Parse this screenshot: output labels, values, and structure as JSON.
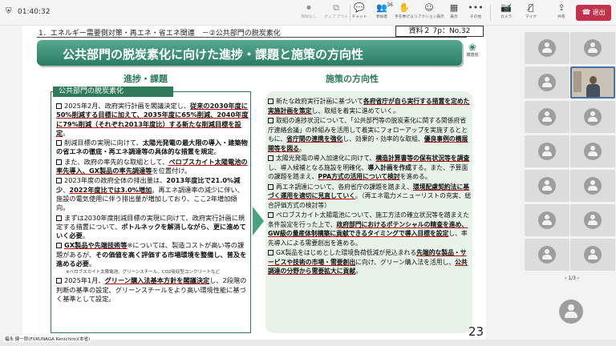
{
  "toolbar": {
    "timer": "01:40:32",
    "items": [
      {
        "icon": "chat-icon",
        "label": "チャット"
      },
      {
        "icon": "people-icon",
        "label": "参加者",
        "count": "36"
      },
      {
        "icon": "hand-icon",
        "label": "手を挙げる"
      },
      {
        "icon": "reaction-icon",
        "label": "リアクション表示"
      },
      {
        "icon": "view-icon",
        "label": "表示"
      },
      {
        "icon": "more-icon",
        "label": "その他"
      },
      {
        "icon": "camera-icon",
        "label": "カメラ"
      },
      {
        "icon": "mic-icon",
        "label": "マイク"
      },
      {
        "icon": "share-icon",
        "label": "共有"
      }
    ],
    "faded": [
      {
        "icon": "record-icon",
        "label": "制限なし"
      },
      {
        "icon": "popout-icon",
        "label": "ポップ アウト"
      }
    ],
    "leave_label": "退出"
  },
  "slide": {
    "doc_header": "1．エネルギー需要側対策・再エネ・省エネ関連　－②公共部門の脱炭素化",
    "doc_tag": "資料２ 7p：No.32",
    "title": "公共部門の脱炭素化に向けた進捗・課題と施策の方向性",
    "logo_label": "環境省",
    "left_heading": "進捗・課題",
    "left_label": "公共部門の脱炭素化",
    "right_heading": "施策の方向性",
    "left_items": [
      {
        "parts": [
          {
            "t": "2025年2月、政府実行計画を閣議決定し、"
          },
          {
            "t": "従来の2030年度に50%削減する目標に加えて、2035年度に65%削減、2040年度に79%削減（それぞれ2013年度比）する新たな削減目標を設定",
            "s": "b ul"
          },
          {
            "t": "。"
          }
        ]
      },
      {
        "parts": [
          {
            "t": "削減目標の実現に向けて、"
          },
          {
            "t": "太陽光発電の最大限の導入・建築物の省エネの徹底・再エネ調達等の具体的な措置を規定",
            "s": "b"
          },
          {
            "t": "。"
          }
        ]
      },
      {
        "parts": [
          {
            "t": "また、政府の率先的な取組として、"
          },
          {
            "t": "ペロブスカイト太陽電池の率先導入、GX製品の率先調達等",
            "s": "b ul"
          },
          {
            "t": "を位置付け。"
          }
        ]
      },
      {
        "parts": [
          {
            "t": "2023年度の政府全体の排出量は、"
          },
          {
            "t": "2013年度比で21.0%減少",
            "s": "b"
          },
          {
            "t": "、"
          },
          {
            "t": "2022年度比では3.0%増加",
            "s": "b ul"
          },
          {
            "t": "。再エネ調達率の減少に伴い、施設の電気使用に伴う排出量が増加しており、ここ2年増加傾向。"
          }
        ]
      },
      {
        "parts": [
          {
            "t": "まずは2030年度削減目標の実現に向けて、政府実行計画に規定する措置について、"
          },
          {
            "t": "ボトルネックを解消しながら、更に進めていく必要",
            "s": "b"
          },
          {
            "t": "。"
          }
        ]
      },
      {
        "parts": [
          {
            "t": "GX製品や先端技術等",
            "s": "b ul"
          },
          {
            "t": "※については、製造コストが高い等の課題があるが、"
          },
          {
            "t": "その価値を高く評価する市場環境を整備し、普及を進める必要",
            "s": "b"
          },
          {
            "t": "。"
          }
        ]
      },
      {
        "note": "※ペロブスカイト太陽電池、グリーンスチール、CO2吸収型コンクリートなど"
      },
      {
        "parts": [
          {
            "t": "2025年1月、"
          },
          {
            "t": "グリーン購入法基本方針を閣議決定",
            "s": "b ul"
          },
          {
            "t": "し、2段階の判断の基準の設定、グリーンスチールをより高い環境性能に基づく基準として設定。"
          }
        ]
      }
    ],
    "right_items": [
      {
        "parts": [
          {
            "t": "新たな政府実行計画に基づいて"
          },
          {
            "t": "各府省庁が自ら実行する措置を定めた実施計画を策定",
            "s": "b ul"
          },
          {
            "t": "し、取組を着実に進めていく。"
          }
        ]
      },
      {
        "parts": [
          {
            "t": "取組の進捗状況について、「公共部門等の脱炭素化に関する関係府省庁連絡会議」の枠組みを活用して着実にフォローアップを実施するとともに、"
          },
          {
            "t": "省庁間の連携を強化",
            "s": "b ul"
          },
          {
            "t": "し、効果的・効率的な取組、"
          },
          {
            "t": "優良事例の横展開等を図る",
            "s": "b ul"
          },
          {
            "t": "。"
          }
        ]
      },
      {
        "parts": [
          {
            "t": "太陽光発電の導入加速化に向けて、"
          },
          {
            "t": "構造計算書等の保有状況等を調査",
            "s": "b ul"
          },
          {
            "t": "し、導入候補となる施設を明確化、"
          },
          {
            "t": "導入計画を作成",
            "s": "b"
          },
          {
            "t": "する。また、予算面の課題を踏まえ、"
          },
          {
            "t": "PPA方式の活用について検討",
            "s": "b ul"
          },
          {
            "t": "を進める。"
          }
        ]
      },
      {
        "parts": [
          {
            "t": "再エネ調達について、各府省庁の課題を踏まえ、"
          },
          {
            "t": "環境配慮契約法に基づく運用を適切に見直していく",
            "s": "b ul"
          },
          {
            "t": "。（再エネ電力メニューリストの充実、総合評価方式の検討等）"
          }
        ]
      },
      {
        "parts": [
          {
            "t": "ペロブスカイト太陽電池について、施工方法の確立状況等を踏まえた条件設定を行った上で、"
          },
          {
            "t": "政府部門におけるポテンシャルの精査を進め、GW級の量産体制構築に貢献できるタイミングで導入目標を設定",
            "s": "b ul"
          },
          {
            "t": "し、率先導入による需要創出を進める。"
          }
        ]
      },
      {
        "parts": [
          {
            "t": "GX製品をはじめとした環境負荷低減が見込まれる"
          },
          {
            "t": "先端的な製品・サービスや技術の市場・需要創出",
            "s": "b ul"
          },
          {
            "t": "に向け、グリーン購入法を活用し、"
          },
          {
            "t": "公共調達の分野から需要拡大に貢献",
            "s": "b ul"
          },
          {
            "t": "。"
          }
        ]
      }
    ],
    "page_number": "23"
  },
  "presenter_name": "福永 健一郎(FUKUNAGA Kenichiro)(本省)",
  "gallery": {
    "pager": "1/3"
  },
  "colors": {
    "banner": "#2a7c63",
    "leave": "#c4314b",
    "right_box": "#e7f3e9"
  }
}
